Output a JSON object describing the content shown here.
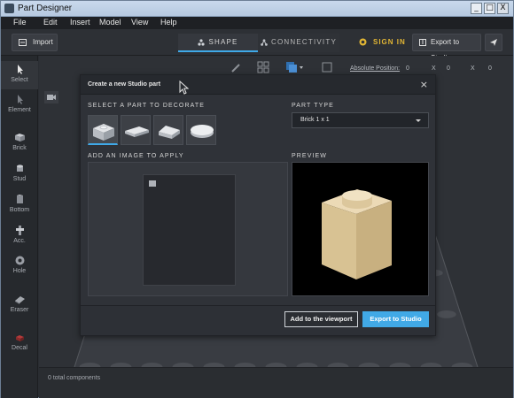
{
  "window": {
    "title": "Part Designer",
    "controls": {
      "minimize": "_",
      "maximize": "□",
      "close": "X"
    }
  },
  "menu": [
    "File",
    "Edit",
    "Insert",
    "Model",
    "View",
    "Help"
  ],
  "toolbar": {
    "import_label": "Import",
    "tabs": [
      {
        "label": "SHAPE",
        "active": true
      },
      {
        "label": "CONNECTIVITY",
        "active": false
      }
    ],
    "signin_label": "SIGN IN",
    "export_label": "Export to Studio"
  },
  "left_tools": [
    "Select",
    "Element",
    "Brick",
    "Stud",
    "Bottom",
    "Acc.",
    "Hole",
    "Eraser",
    "Decal"
  ],
  "viewport": {
    "absolute_position_label": "Absolute Position:",
    "coords": [
      "0",
      "X",
      "0",
      "X",
      "0"
    ]
  },
  "status": {
    "components": "0 total components"
  },
  "modal": {
    "title": "Create a new Studio part",
    "close": "×",
    "section_select": "SELECT A PART TO DECORATE",
    "section_part_type": "PART TYPE",
    "section_image": "ADD AN IMAGE TO APPLY",
    "section_preview": "PREVIEW",
    "parts": [
      {
        "name": "brick",
        "selected": true
      },
      {
        "name": "plate",
        "selected": false
      },
      {
        "name": "slope",
        "selected": false
      },
      {
        "name": "round",
        "selected": false
      }
    ],
    "part_type_value": "Brick 1 x 1",
    "add_button": "Add to the viewport",
    "export_button": "Export to Studio"
  },
  "colors": {
    "accent": "#41a9e6",
    "signin": "#e2b634",
    "brick": "#e4cd9e"
  }
}
